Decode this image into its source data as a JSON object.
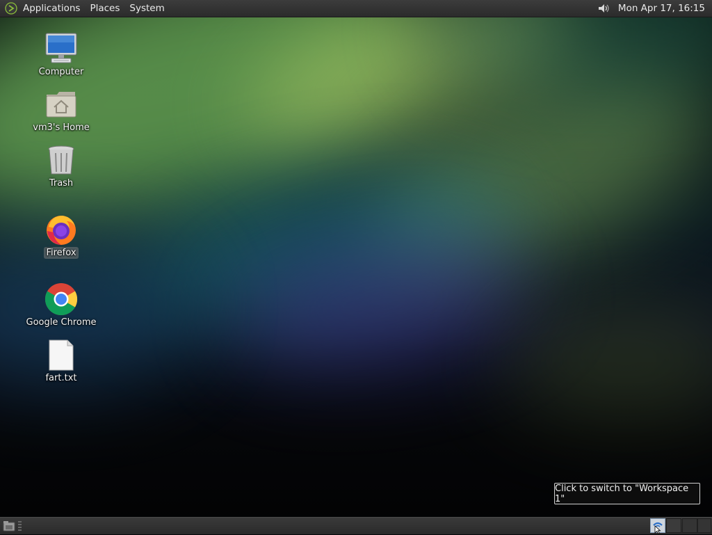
{
  "top_panel": {
    "menus": [
      {
        "label": "Applications"
      },
      {
        "label": "Places"
      },
      {
        "label": "System"
      }
    ],
    "clock": "Mon Apr 17, 16:15",
    "icons": [
      "distro-logo-icon",
      "volume-icon"
    ]
  },
  "desktop": {
    "icons": [
      {
        "label": "Computer",
        "icon": "computer-icon"
      },
      {
        "label": "vm3's Home",
        "icon": "home-folder-icon"
      },
      {
        "label": "Trash",
        "icon": "trash-icon"
      },
      {
        "label": "Firefox",
        "icon": "firefox-icon",
        "selected": true
      },
      {
        "label": "Google Chrome",
        "icon": "chrome-icon"
      },
      {
        "label": "fart.txt",
        "icon": "text-file-icon"
      }
    ]
  },
  "tooltip": {
    "text": "Click to switch to \"Workspace 1\""
  },
  "bottom_panel": {
    "icons": [
      "show-desktop-icon"
    ],
    "workspaces": [
      {
        "name": "Workspace 1",
        "active": true
      },
      {
        "name": "Workspace 2",
        "active": false
      },
      {
        "name": "Workspace 3",
        "active": false
      },
      {
        "name": "Workspace 4",
        "active": false
      }
    ]
  },
  "colors": {
    "panel": "#2e2e2e",
    "tooltip_bg": "#0d0d0d",
    "active_workspace": "#cfd6de"
  }
}
